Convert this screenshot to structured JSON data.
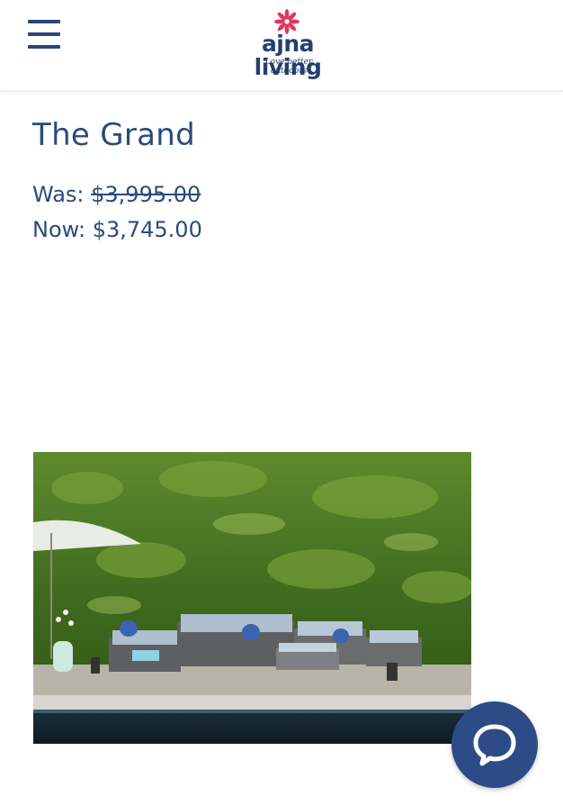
{
  "header": {
    "menu_icon": "hamburger-menu-icon",
    "logo": {
      "wordmark": "ajna living",
      "tagline": "Love better outdoors",
      "icon": "flower-icon",
      "icon_color": "#e0365e"
    }
  },
  "product": {
    "title": "The Grand",
    "was_label": "Was:",
    "was_price": "$3,995.00",
    "now_label": "Now:",
    "now_price": "$3,745.00",
    "image": "outdoor-wicker-sectional-sofa-set-by-pool-photo"
  },
  "chat": {
    "icon": "chat-bubble-icon"
  },
  "colors": {
    "brand": "#2a4b7c",
    "chat_button": "#2d4b86",
    "accent": "#e0365e"
  }
}
